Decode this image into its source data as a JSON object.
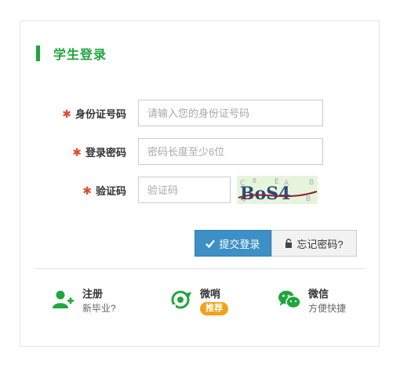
{
  "panel": {
    "title": "学生登录"
  },
  "form": {
    "id_label": "身份证号码",
    "id_placeholder": "请输入您的身份证号码",
    "password_label": "登录密码",
    "password_placeholder": "密码长度至少6位",
    "captcha_label": "验证码",
    "captcha_placeholder": "验证码",
    "captcha_text": "BoS4",
    "required_mark": "✱"
  },
  "buttons": {
    "submit_label": "提交登录",
    "forgot_label": "忘记密码?"
  },
  "links": [
    {
      "name": "注册",
      "sub": "新毕业?",
      "icon": "add-user-icon"
    },
    {
      "name": "微哨",
      "badge": "推荐",
      "icon": "weishao-icon"
    },
    {
      "name": "微信",
      "sub": "方便快捷",
      "icon": "wechat-icon"
    }
  ],
  "colors": {
    "accent": "#1fa63c",
    "button": "#3d8fc6",
    "required": "#e04a2f",
    "badge": "#f0a21b"
  }
}
